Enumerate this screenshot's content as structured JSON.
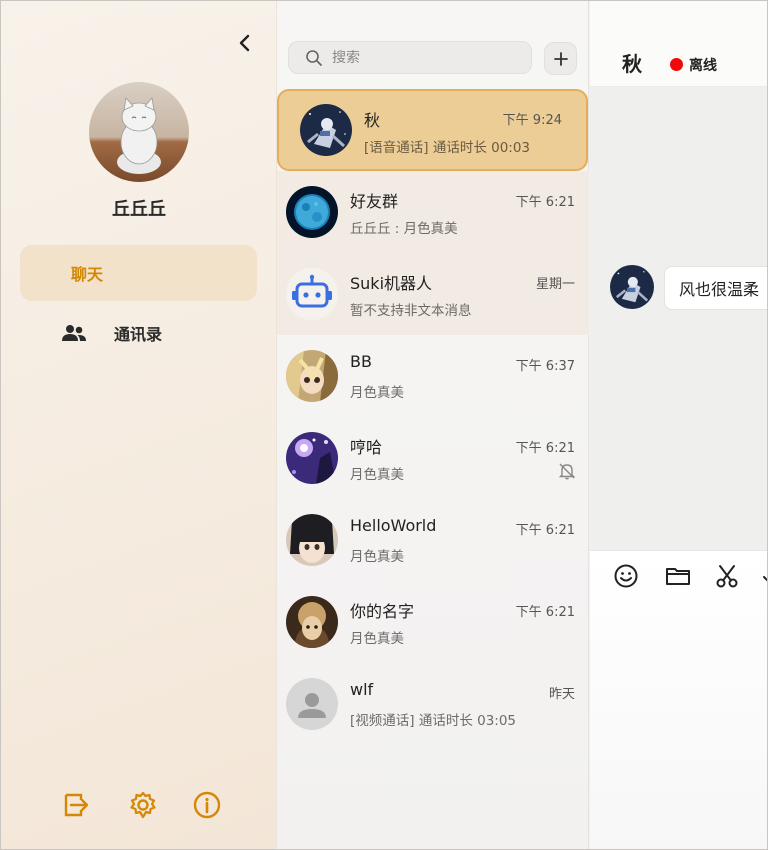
{
  "sidebar": {
    "username": "丘丘丘",
    "nav": [
      {
        "label": "聊天",
        "active": true
      },
      {
        "label": "通讯录",
        "active": false
      }
    ],
    "icons": {
      "collapse": "chevron-left-icon",
      "logout": "logout-icon",
      "settings": "gear-icon",
      "info": "info-icon"
    },
    "accent_color": "#d48806"
  },
  "list": {
    "search_placeholder": "搜索",
    "add_label": "+",
    "conversations": [
      {
        "name": "秋",
        "time": "下午 9:24",
        "last": "[语音通话] 通话时长 00:03",
        "selected": true
      },
      {
        "name": "好友群",
        "time": "下午 6:21",
        "last": "丘丘丘 : 月色真美",
        "pinned": true
      },
      {
        "name": "Suki机器人",
        "time": "星期一",
        "last": "暂不支持非文本消息",
        "pinned": true
      },
      {
        "name": "BB",
        "time": "下午 6:37",
        "last": "月色真美"
      },
      {
        "name": "哼哈",
        "time": "下午 6:21",
        "last": "月色真美",
        "muted": true
      },
      {
        "name": "HelloWorld",
        "time": "下午 6:21",
        "last": "月色真美"
      },
      {
        "name": "你的名字",
        "time": "下午 6:21",
        "last": "月色真美"
      },
      {
        "name": "wlf",
        "time": "昨天",
        "last": "[视频通话] 通话时长 03:05"
      }
    ]
  },
  "chat": {
    "title": "秋",
    "status": "离线",
    "status_color": "#ee0a0a",
    "messages": [
      {
        "text": "风也很温柔"
      }
    ],
    "tools": [
      "emoji-icon",
      "folder-icon",
      "scissors-icon",
      "check-icon"
    ]
  }
}
